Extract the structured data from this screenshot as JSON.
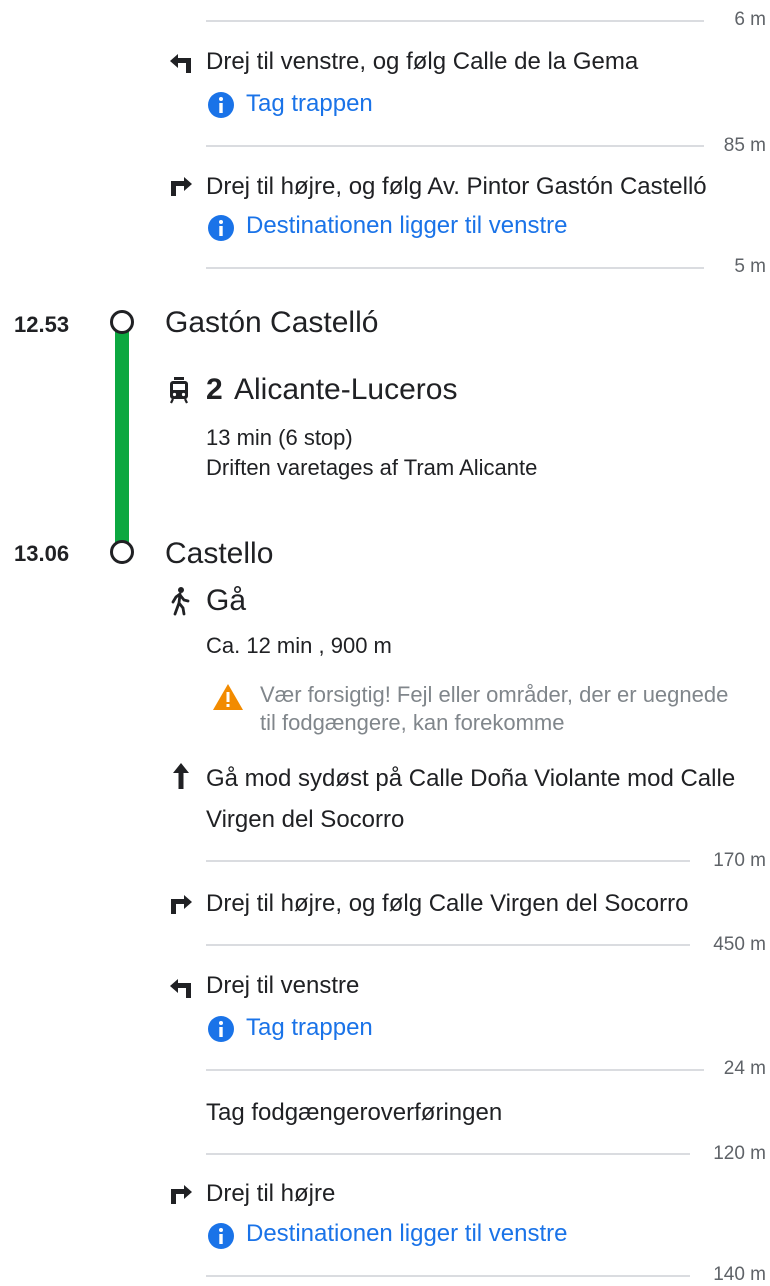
{
  "pre_steps": {
    "dist0": "6 m",
    "step1": {
      "text": "Drej til venstre, og følg Calle de la Gema",
      "note": "Tag trappen",
      "dist": "85 m"
    },
    "step2": {
      "text": "Drej til højre, og følg Av. Pintor Gastón Castelló",
      "note": "Destinationen ligger til venstre",
      "dist": "5 m"
    }
  },
  "transit": {
    "depart_time": "12.53",
    "depart_stop": "Gastón Castelló",
    "line_number": "2",
    "line_name": "Alicante-Luceros",
    "duration": "13 min (6 stop)",
    "operator": "Driften varetages af Tram Alicante",
    "arrive_time": "13.06",
    "arrive_stop": "Castello",
    "line_color": "#0ca840"
  },
  "walk": {
    "mode": "Gå",
    "summary": "Ca. 12 min , 900 m",
    "warning": "Vær forsigtig! Fejl eller områder, der er uegnede til fodgængere, kan forekomme",
    "steps": [
      {
        "text1": "Gå mod sydøst på Calle Doña Violante mod Calle",
        "text2": "Virgen del Socorro",
        "dist": "170 m"
      },
      {
        "text": "Drej til højre, og følg Calle Virgen del Socorro",
        "dist": "450 m"
      },
      {
        "text": "Drej til venstre",
        "note": "Tag trappen",
        "dist": "24 m"
      },
      {
        "text": "Tag fodgængeroverføringen",
        "dist": "120 m"
      },
      {
        "text": "Drej til højre",
        "note": "Destinationen ligger til venstre",
        "dist": "140 m"
      }
    ]
  }
}
